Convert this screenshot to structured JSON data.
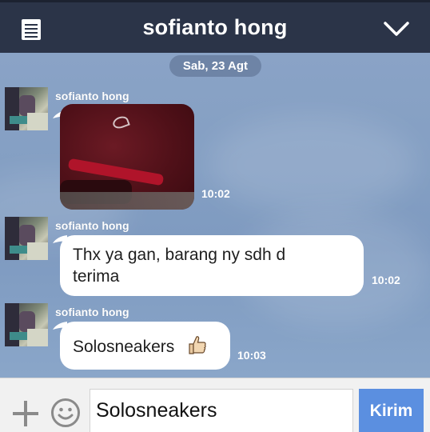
{
  "header": {
    "title": "sofianto hong",
    "left_icon": "notes-icon",
    "right_icon": "chevron-down-icon"
  },
  "chat": {
    "date": "Sab, 23 Agt",
    "messages": [
      {
        "sender": "sofianto hong",
        "type": "image",
        "time": "10:02"
      },
      {
        "sender": "sofianto hong",
        "type": "text",
        "line1": "Thx ya gan,  barang ny sdh d",
        "line2": "terima",
        "time": "10:02"
      },
      {
        "sender": "sofianto hong",
        "type": "text",
        "text": "Solosneakers",
        "emoji": "thumbs-up-icon",
        "time": "10:03"
      }
    ]
  },
  "composer": {
    "value": "Solosneakers",
    "send_label": "Kirim",
    "add_icon": "plus-icon",
    "emoji_icon": "smiley-icon"
  },
  "colors": {
    "header_bg": "#2b3448",
    "chat_bg": "#8aa3c6",
    "send_button": "#5b8fe0"
  }
}
